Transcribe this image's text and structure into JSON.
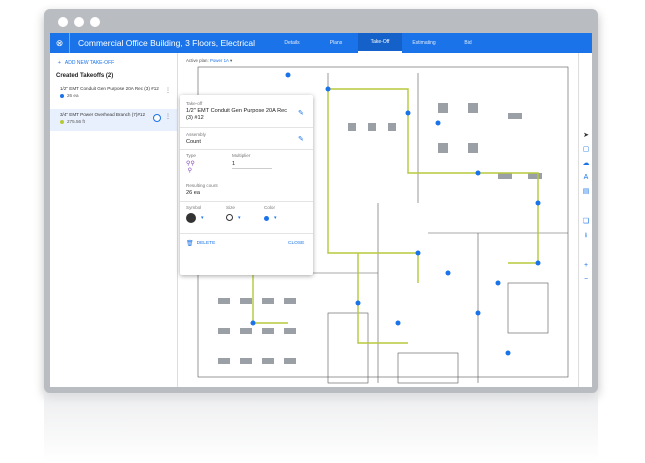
{
  "app": {
    "project_title": "Commercial Office Building, 3 Floors, Electrical",
    "tabs": [
      {
        "label": "Details"
      },
      {
        "label": "Plans"
      },
      {
        "label": "Take-Off"
      },
      {
        "label": "Estimating"
      },
      {
        "label": "Bid"
      }
    ],
    "active_tab": "Take-Off"
  },
  "sidebar": {
    "add_label": "ADD NEW TAKE-OFF",
    "section_title": "Created Takeoffs (2)",
    "items": [
      {
        "name": "1/2\" EMT Conduit Gen Purpose 20A Rec (3) #12",
        "count": "26 ea",
        "color": "#1a73e8"
      },
      {
        "name": "3/4\" EMT Power Overhead Branch (7)#12",
        "count": "275.56 ft",
        "color": "#b5c93a"
      }
    ]
  },
  "canvas": {
    "active_plan_label": "Active plan:",
    "active_plan_value": "Power 1A"
  },
  "panel": {
    "takeoff_label": "Take-off",
    "takeoff_value": "1/2\" EMT Conduit Gen Purpose 20A Rec (3) #12",
    "assembly_label": "Assembly",
    "assembly_value": "Count",
    "type_label": "Type",
    "multiplier_label": "Multiplier",
    "multiplier_value": "1",
    "result_label": "Resulting count",
    "result_value": "26 ea",
    "symbol_label": "Symbol",
    "size_label": "Size",
    "color_label": "Color",
    "delete_label": "DELETE",
    "close_label": "CLOSE"
  }
}
